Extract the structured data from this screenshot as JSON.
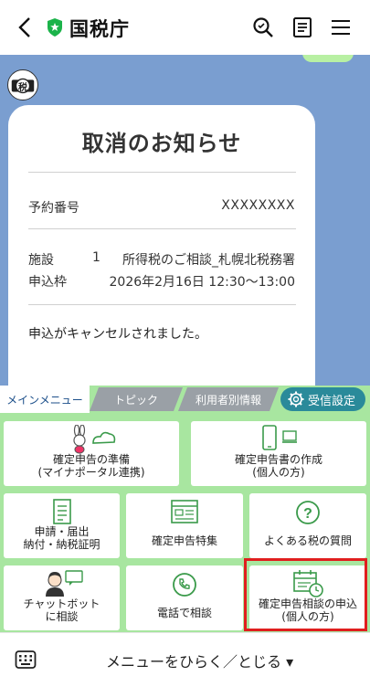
{
  "header": {
    "title": "国税庁",
    "back_icon": "back-arrow-icon",
    "badge_icon": "verified-shield-icon",
    "actions": [
      "search-icon",
      "notes-icon",
      "menu-icon"
    ]
  },
  "chat": {
    "avatar_text": "税",
    "card": {
      "title": "取消のお知らせ",
      "reservation_label": "予約番号",
      "reservation_value": "XXXXXXXX",
      "facility_label": "施設",
      "facility_number": "1",
      "facility_value": "所得税のご相談_札幌北税務署",
      "slot_label": "申込枠",
      "slot_value": "2026年2月16日 12:30〜13:00",
      "notice": "申込がキャンセルされました。"
    }
  },
  "menu_tabs": {
    "main": "メインメニュー",
    "topic": "トピック",
    "user_info": "利用者別情報",
    "settings": "受信設定"
  },
  "menu_items": [
    {
      "line1": "確定申告の準備",
      "line2": "(マイナポータル連携)",
      "icon": "rabbit-cloud-icon"
    },
    {
      "line1": "確定申告書の作成",
      "line2": "(個人の方)",
      "icon": "smartphone-pc-icon"
    },
    {
      "line1": "申請・届出",
      "line2": "納付・納税証明",
      "icon": "document-icon"
    },
    {
      "line1": "確定申告特集",
      "line2": "",
      "icon": "browser-window-icon"
    },
    {
      "line1": "よくある税の質問",
      "line2": "",
      "icon": "question-icon"
    },
    {
      "line1": "チャットボット",
      "line2": "に相談",
      "icon": "chatbot-operator-icon"
    },
    {
      "line1": "電話で相談",
      "line2": "",
      "icon": "phone-icon"
    },
    {
      "line1": "確定申告相談の申込",
      "line2": "(個人の方)",
      "icon": "calendar-clock-icon"
    }
  ],
  "bottom_bar": {
    "keyboard_icon": "keyboard-icon",
    "toggle_label": "メニューをひらく／とじる ▾"
  },
  "colors": {
    "chat_bg": "#7a9ed0",
    "menu_bg": "#a8e6a0",
    "icon_green": "#3a9a4a",
    "highlight": "#e01e1e",
    "settings_btn": "#2a8a9a"
  }
}
